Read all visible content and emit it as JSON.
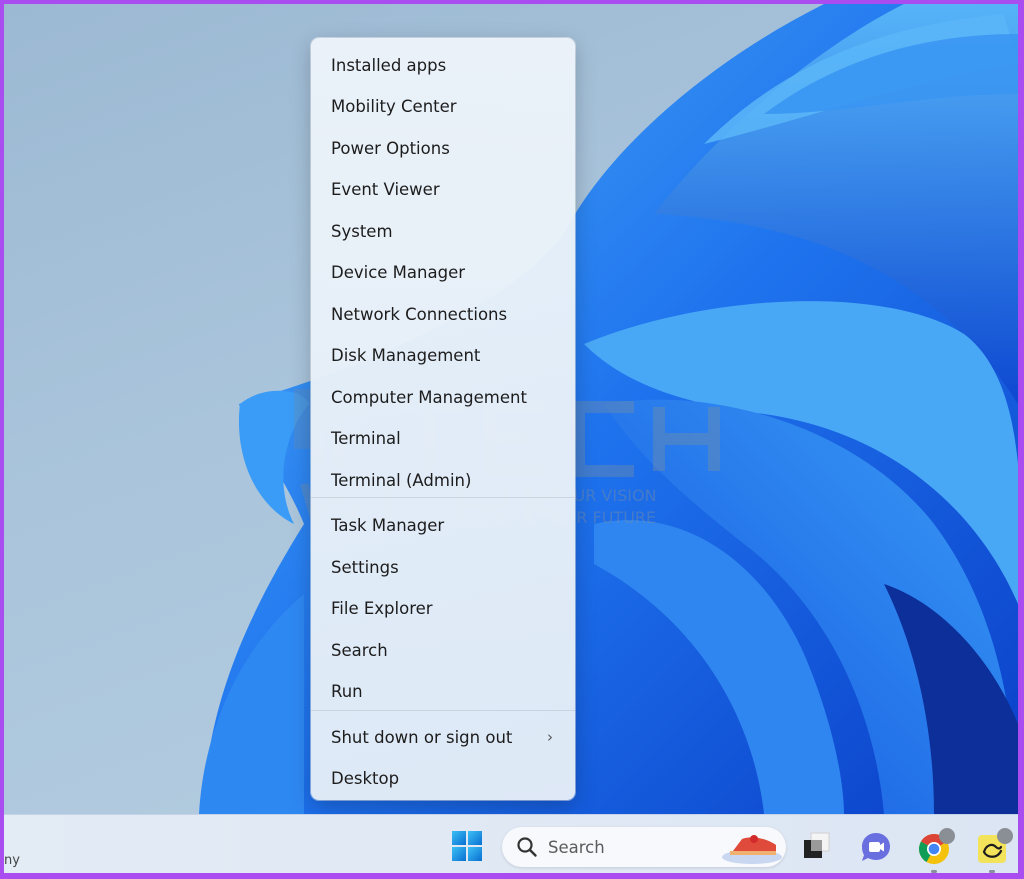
{
  "context_menu": {
    "items": [
      {
        "label": "Installed apps"
      },
      {
        "label": "Mobility Center"
      },
      {
        "label": "Power Options"
      },
      {
        "label": "Event Viewer"
      },
      {
        "label": "System"
      },
      {
        "label": "Device Manager"
      },
      {
        "label": "Network Connections"
      },
      {
        "label": "Disk Management"
      },
      {
        "label": "Computer Management"
      },
      {
        "label": "Terminal"
      },
      {
        "label": "Terminal (Admin)"
      },
      {
        "label": "Task Manager"
      },
      {
        "label": "Settings"
      },
      {
        "label": "File Explorer"
      },
      {
        "label": "Search"
      },
      {
        "label": "Run"
      },
      {
        "label": "Shut down or sign out",
        "submenu": true
      },
      {
        "label": "Desktop"
      }
    ],
    "submenu_glyph": "›"
  },
  "taskbar": {
    "weather_text": "ny",
    "search": {
      "label": "Search",
      "icon": "search-icon",
      "highlight_icon": "cherry-pie-icon"
    },
    "apps": [
      {
        "name": "start-button",
        "icon": "windows-logo-icon"
      },
      {
        "name": "task-view",
        "icon": "task-view-icon"
      },
      {
        "name": "teams-meet",
        "icon": "video-chat-icon"
      },
      {
        "name": "chrome",
        "icon": "chrome-icon",
        "running": true
      },
      {
        "name": "basecamp",
        "icon": "basecamp-icon",
        "running": true
      }
    ]
  },
  "watermark": {
    "line1": "TECH",
    "line2": "WORK",
    "tagline1": "YOUR VISION",
    "tagline2": "OUR FUTURE"
  },
  "colors": {
    "frame_border": "#a94df0",
    "wallpaper_blue": "#1a6cf0",
    "menu_bg": "#e8f0f8",
    "win_blue": "#1f8fe0"
  }
}
